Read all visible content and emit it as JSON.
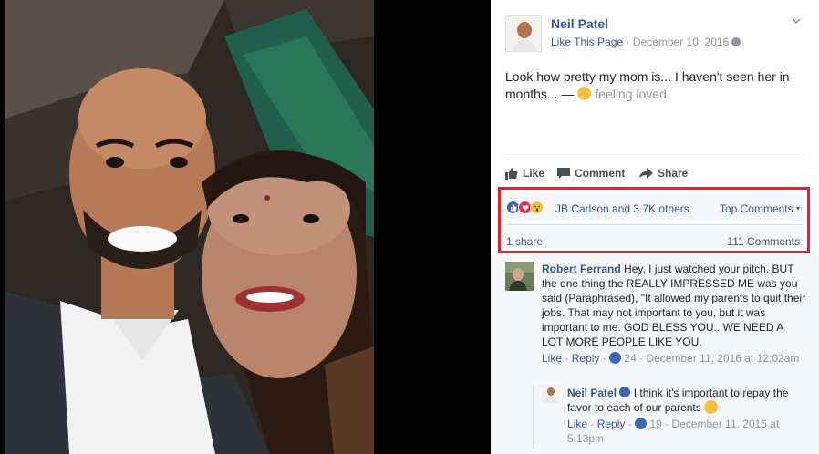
{
  "post": {
    "author": "Neil Patel",
    "like_page": "Like This Page",
    "separator": " · ",
    "date": "December 10, 2016",
    "privacy_icon": "globe-icon",
    "text": "Look how pretty my mom is... I haven't seen her in months... — ",
    "feeling": "feeling loved."
  },
  "actions": {
    "like": "Like",
    "comment": "Comment",
    "share": "Share"
  },
  "reactions": {
    "names": "JB Carlson and 3.7K others",
    "top_comments": "Top Comments",
    "shares": "1 share",
    "comments": "111 Comments",
    "colors": {
      "like": "#4267b2",
      "love": "#f0284a",
      "wow": "#f7c23a",
      "highlight": "#e0242f"
    }
  },
  "comments": [
    {
      "name": "Robert Ferrand",
      "text": "Hey, I just watched your pitch. BUT the one thing the REALLY IMPRESSED ME was you said (Paraphrased), \"It allowed my parents to quit their jobs. That may not important to you, but it was important to me. GOD BLESS YOU...WE NEED A LOT MORE PEOPLE LIKE YOU.",
      "like": "Like",
      "reply": "Reply",
      "likes": "24",
      "date": "December 11, 2016 at 12:02am"
    },
    {
      "name": "Neil Patel",
      "text": "I think it's important to repay the favor to each of our parents",
      "like": "Like",
      "reply": "Reply",
      "likes": "19",
      "date": "December 11, 2016 at 5:13pm"
    }
  ]
}
